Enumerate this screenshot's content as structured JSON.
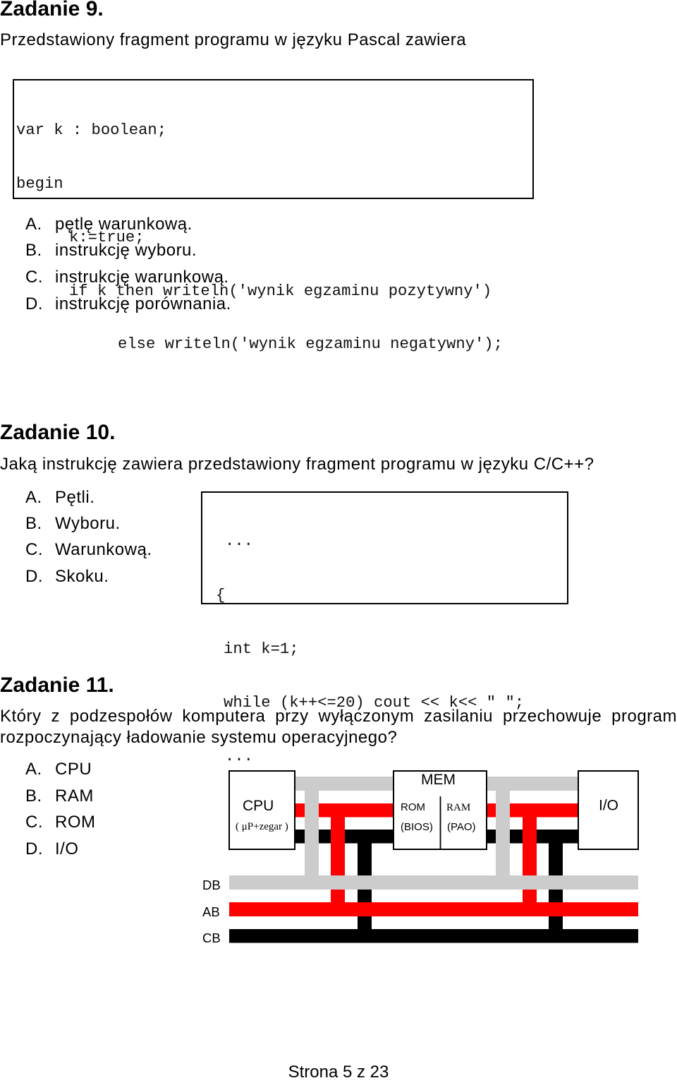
{
  "tasks": [
    {
      "heading": "Zadanie 9.",
      "question": "Przedstawiony fragment programu w języku Pascal zawiera",
      "code": [
        "var k : boolean;",
        "begin",
        "k:=true;",
        "if k then writeln('wynik egzaminu pozytywny')",
        "else writeln('wynik egzaminu negatywny');"
      ],
      "options": [
        {
          "letter": "A.",
          "text": "pętlę warunkową."
        },
        {
          "letter": "B.",
          "text": "instrukcję wyboru."
        },
        {
          "letter": "C.",
          "text": "instrukcję warunkową."
        },
        {
          "letter": "D.",
          "text": "instrukcję porównania."
        }
      ]
    },
    {
      "heading": "Zadanie 10.",
      "question": "Jaką instrukcję zawiera przedstawiony fragment programu w języku C/C++?",
      "code": [
        "...",
        "{",
        "int k=1;",
        "while (k++<=20) cout << k<< \" \";",
        "..."
      ],
      "options": [
        {
          "letter": "A.",
          "text": "Pętli."
        },
        {
          "letter": "B.",
          "text": "Wyboru."
        },
        {
          "letter": "C.",
          "text": "Warunkową."
        },
        {
          "letter": "D.",
          "text": "Skoku."
        }
      ]
    },
    {
      "heading": "Zadanie 11.",
      "question": "Który z podzespołów komputera przy wyłączonym zasilaniu przechowuje program rozpoczynający ładowanie systemu operacyjnego?",
      "options": [
        {
          "letter": "A.",
          "text": "CPU"
        },
        {
          "letter": "B.",
          "text": "RAM"
        },
        {
          "letter": "C.",
          "text": "ROM"
        },
        {
          "letter": "D.",
          "text": "I/O"
        }
      ]
    }
  ],
  "diagram": {
    "cpu": {
      "label": "CPU",
      "sublabel": "( μP+zegar )"
    },
    "mem": {
      "label": "MEM",
      "rom": "ROM",
      "rom_sub": "(BIOS)",
      "ram": "RAM",
      "ram_sub": "(PAO)"
    },
    "io": {
      "label": "I/O"
    },
    "buses": {
      "data": "DB",
      "address": "AB",
      "control": "CB"
    },
    "colors": {
      "data_bus": "#cccccc",
      "address_bus": "#ff0000",
      "control_bus": "#000000",
      "box_border": "#000000"
    }
  },
  "footer": "Strona 5 z 23"
}
